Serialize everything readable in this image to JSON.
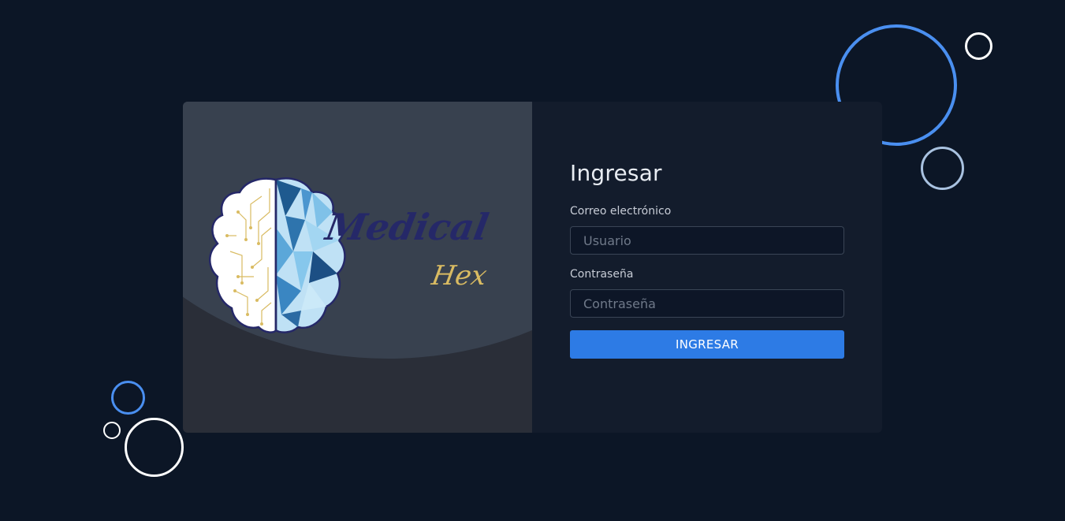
{
  "brand": {
    "logo_word1": "Medical",
    "logo_word2": "Hex"
  },
  "login": {
    "title": "Ingresar",
    "email_label": "Correo electrónico",
    "email_placeholder": "Usuario",
    "email_value": "",
    "password_label": "Contraseña",
    "password_placeholder": "Contraseña",
    "password_value": "",
    "submit_label": "INGRESAR"
  },
  "colors": {
    "page_background": "#0c1626",
    "form_panel": "#131c2c",
    "accent_button": "#2d7be5",
    "ring_blue": "#4a8ff0",
    "ring_pale": "#a9c2e0",
    "ring_white": "#ffffff",
    "logo_navy": "#252868",
    "logo_gold": "#d9bb62"
  }
}
